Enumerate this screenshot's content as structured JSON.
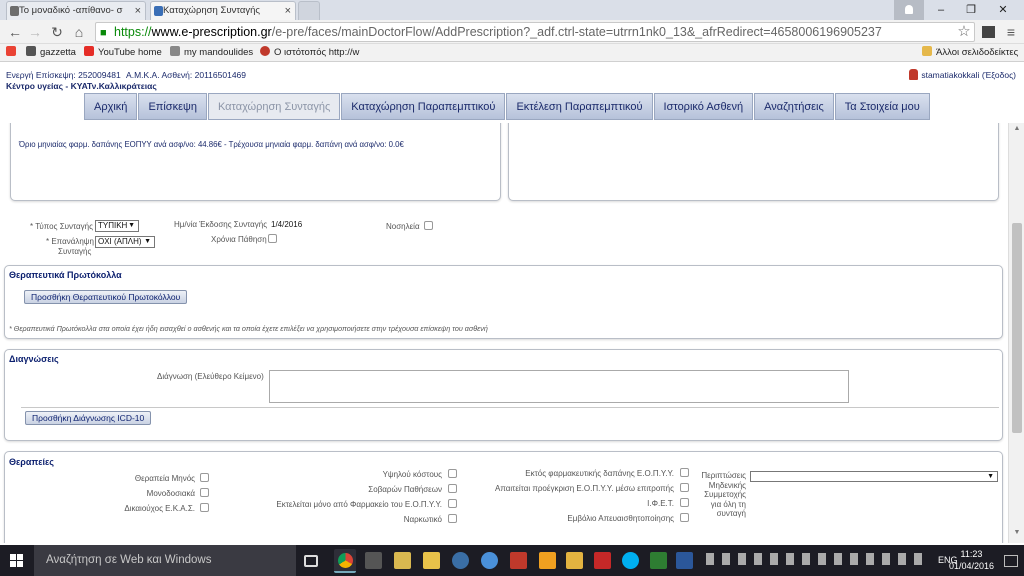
{
  "browser": {
    "tabs": [
      {
        "title": "Το μοναδικό -απίθανο- σ",
        "active": false
      },
      {
        "title": "Καταχώρηση Συνταγής",
        "active": true
      }
    ],
    "close_glyph": "×",
    "window_controls": {
      "minimize": "–",
      "restore": "❐",
      "close": "✕"
    },
    "url": {
      "scheme": "https://",
      "host": "www.e-prescription.gr",
      "path": "/e-pre/faces/mainDoctorFlow/AddPrescription?_adf.ctrl-state=utrrn1nk0_13&_afrRedirect=4658006196905237"
    },
    "star": "☆",
    "menu_glyph": "≡",
    "nav": {
      "back": "←",
      "forward": "→",
      "reload": "↻",
      "home": "⌂"
    },
    "bookmarks": [
      {
        "label": "",
        "icon": "apps-icon",
        "color": "#ea4335"
      },
      {
        "label": "gazzetta",
        "icon": "gazzetta-icon",
        "color": "#555555"
      },
      {
        "label": "YouTube home",
        "icon": "youtube-icon",
        "color": "#e52d27"
      },
      {
        "label": "my mandoulides",
        "icon": "mandoulides-icon",
        "color": "#888888"
      },
      {
        "label": "Ο ιστότοπός http://w",
        "icon": "site-icon",
        "color": "#c0392b"
      }
    ],
    "other_bookmarks": "Άλλοι σελιδοδείκτες"
  },
  "header": {
    "visit_label": "Ενεργή Επίσκεψη:",
    "visit_value": "252009481",
    "amka_label": "Α.Μ.Κ.Α. Ασθενή:",
    "amka_value": "20116501469",
    "center": "Κέντρο υγείας - ΚΥΑΤν.Καλλικράτειας",
    "user": "stamatiakokkali",
    "logout": "(Έξοδος)"
  },
  "menu": [
    {
      "label": "Αρχική",
      "active": false
    },
    {
      "label": "Επίσκεψη",
      "active": false
    },
    {
      "label": "Καταχώρηση Συνταγής",
      "active": true
    },
    {
      "label": "Καταχώρηση Παραπεμπτικού",
      "active": false
    },
    {
      "label": "Εκτέλεση Παραπεμπτικού",
      "active": false
    },
    {
      "label": "Ιστορικό Ασθενή",
      "active": false
    },
    {
      "label": "Αναζητήσεις",
      "active": false
    },
    {
      "label": "Τα Στοιχεία μου",
      "active": false
    }
  ],
  "limits_text": "Όριο μηνιαίας φαρμ. δαπάνης ΕΟΠΥΥ ανά ασφ/νο: 44.86€ - Τρέχουσα μηνιαία φαρμ. δαπάνη ανά ασφ/νο: 0.0€",
  "form": {
    "type_label": "* Τύπος Συνταγής",
    "type_value": "ΤΥΠΙΚΗ",
    "repeat_label_1": "* Επανάληψη",
    "repeat_label_2": "Συνταγής",
    "repeat_value": "ΟΧΙ (ΑΠΛΗ)",
    "issue_date_label": "Ημ/νία Έκδοσης Συνταγής",
    "issue_date_value": "1/4/2016",
    "chronic_label": "Χρόνια Πάθηση",
    "hospital_label": "Νοσηλεία",
    "select_arrow": "▼"
  },
  "protocols": {
    "title": "Θεραπευτικά Πρωτόκολλα",
    "button": "Προσθήκη Θεραπευτικού Πρωτοκόλλου",
    "note": "* Θεραπευτικά Πρωτόκολλα στα οποία έχει ήδη εισαχθεί ο ασθενής και τα οποία έχετε επιλέξει να χρησιμοποιήσετε στην τρέχουσα επίσκεψη του ασθενή"
  },
  "diagnoses": {
    "title": "Διαγνώσεις",
    "freetext_label": "Διάγνωση (Ελεύθερο Κείμενο)",
    "button": "Προσθήκη Διάγνωσης ICD-10"
  },
  "therapies": {
    "title": "Θεραπείες",
    "col1": [
      "Θεραπεία Μηνός",
      "Μονοδοσιακά",
      "Δικαιούχος Ε.Κ.Α.Σ."
    ],
    "col2": [
      "Υψηλού κόστους",
      "Σοβαρών Παθήσεων",
      "Εκτελείται μόνο από Φαρμακείο του Ε.Ο.Π.Υ.Υ.",
      "Ναρκωτικό"
    ],
    "col3": [
      "Εκτός φαρμακευτικής δαπάνης Ε.Ο.Π.Υ.Υ.",
      "Απαιτείται προέγκριση Ε.Ο.Π.Υ.Υ. μέσω επιτροπής",
      "Ι.Φ.Ε.Τ.",
      "Εμβόλιο Απευαισθητοποίησης"
    ],
    "participation_label": [
      "Περιπτώσεις",
      "Μηδενικής",
      "Συμμετοχής",
      "για όλη τη",
      "συνταγή"
    ]
  },
  "taskbar": {
    "search_placeholder": "Αναζήτηση σε Web και Windows",
    "lang": "ENG",
    "time": "11:23",
    "date": "01/04/2016"
  }
}
